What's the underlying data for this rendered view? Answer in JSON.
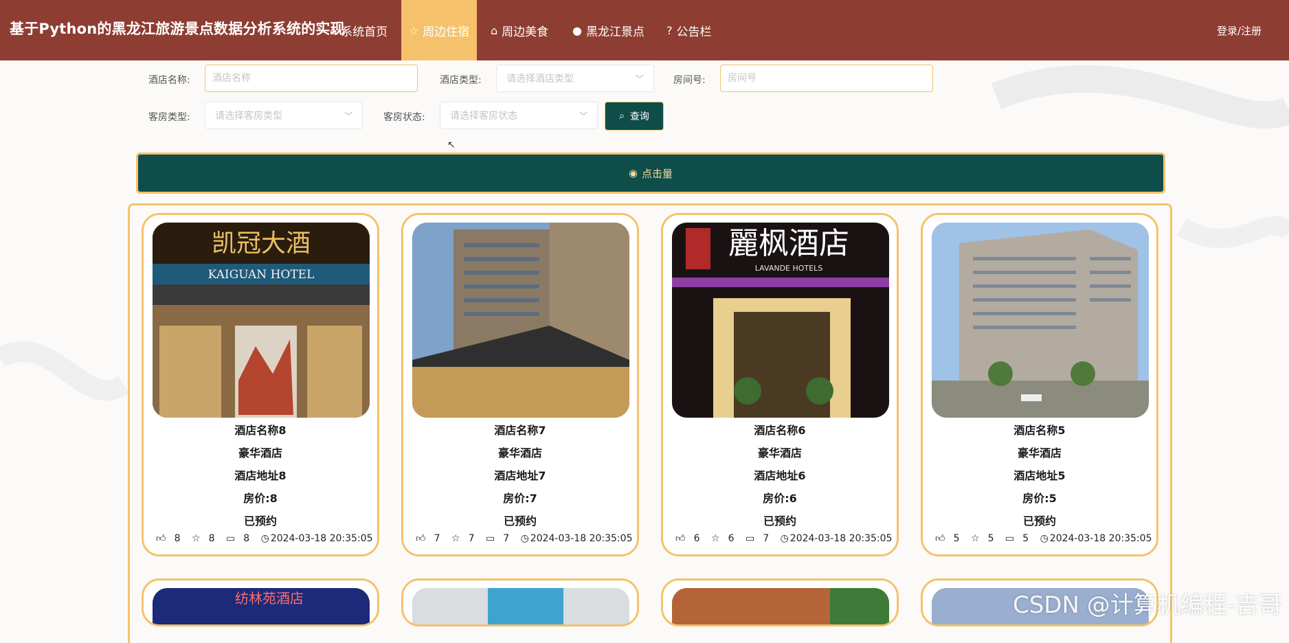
{
  "header": {
    "brand": "基于Python的黑龙江旅游景点数据分析系统的实现",
    "nav": [
      {
        "label": "系统首页",
        "icon": "home-icon"
      },
      {
        "label": "周边住宿",
        "icon": "star-icon",
        "active": true
      },
      {
        "label": "周边美食",
        "icon": "bag-icon"
      },
      {
        "label": "黑龙江景点",
        "icon": "info-icon"
      },
      {
        "label": "公告栏",
        "icon": "question-icon"
      }
    ],
    "login": "登录/注册"
  },
  "filters": {
    "hotel_name_label": "酒店名称:",
    "hotel_name_placeholder": "酒店名称",
    "hotel_type_label": "酒店类型:",
    "hotel_type_placeholder": "请选择酒店类型",
    "room_no_label": "房间号:",
    "room_no_placeholder": "房间号",
    "room_type_label": "客房类型:",
    "room_type_placeholder": "请选择客房类型",
    "room_status_label": "客房状态:",
    "room_status_placeholder": "请选择客房状态",
    "query_label": "查询"
  },
  "click_bar": {
    "label": "点击量"
  },
  "cards": [
    {
      "name": "酒店名称8",
      "type": "豪华酒店",
      "address": "酒店地址8",
      "price": "房价:8",
      "status": "已预约",
      "likes": "8",
      "favs": "8",
      "comments": "8",
      "time": "2024-03-18 20:35:05",
      "sign": "凯冠大酒",
      "sign_sub": "KAIGUAN HOTEL"
    },
    {
      "name": "酒店名称7",
      "type": "豪华酒店",
      "address": "酒店地址7",
      "price": "房价:7",
      "status": "已预约",
      "likes": "7",
      "favs": "7",
      "comments": "7",
      "time": "2024-03-18 20:35:05",
      "sign": "",
      "sign_sub": ""
    },
    {
      "name": "酒店名称6",
      "type": "豪华酒店",
      "address": "酒店地址6",
      "price": "房价:6",
      "status": "已预约",
      "likes": "6",
      "favs": "6",
      "comments": "7",
      "time": "2024-03-18 20:35:05",
      "sign": "麗枫酒店",
      "sign_sub": "LAVANDE HOTELS"
    },
    {
      "name": "酒店名称5",
      "type": "豪华酒店",
      "address": "酒店地址5",
      "price": "房价:5",
      "status": "已预约",
      "likes": "5",
      "favs": "5",
      "comments": "5",
      "time": "2024-03-18 20:35:05",
      "sign": "",
      "sign_sub": ""
    }
  ],
  "next_row_signs": [
    "纺林苑酒店"
  ],
  "watermark": "CSDN @计算机编程-吉哥",
  "colors": {
    "header": "#8e3d33",
    "accent": "#f5c26b",
    "teal": "#0f4d4a"
  }
}
